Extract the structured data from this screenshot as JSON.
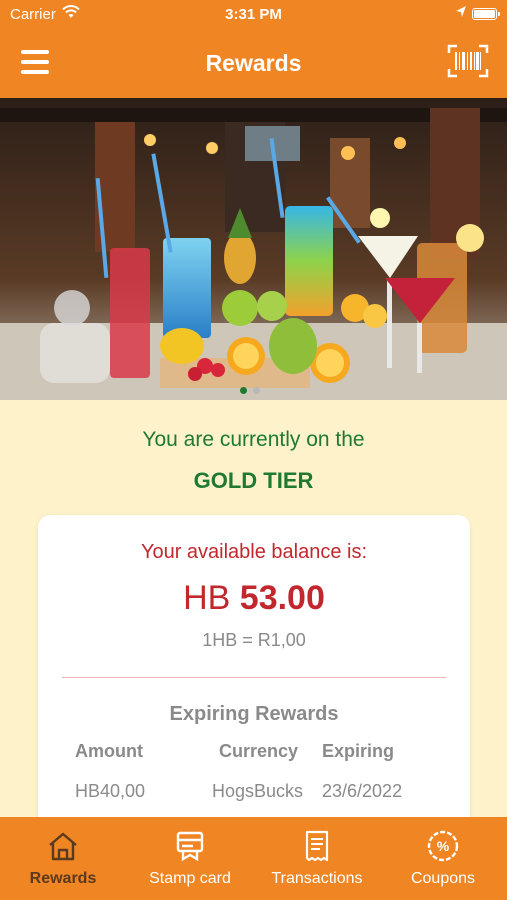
{
  "status_bar": {
    "carrier": "Carrier",
    "time": "3:31 PM"
  },
  "nav": {
    "title": "Rewards",
    "menu_icon": "hamburger-menu-icon",
    "scan_icon": "barcode-scan-icon"
  },
  "tier": {
    "prefix": "You are currently on the",
    "name": "GOLD TIER"
  },
  "balance": {
    "label": "Your available balance is:",
    "currency": "HB",
    "amount": "53.00",
    "rate": "1HB = R1,00"
  },
  "expiring": {
    "title": "Expiring Rewards",
    "headers": [
      "Amount",
      "Currency",
      "Expiring"
    ],
    "rows": [
      [
        "HB40,00",
        "HogsBucks",
        "23/6/2022"
      ]
    ]
  },
  "carousel": {
    "active_index": 0,
    "count": 2
  },
  "tabs": [
    {
      "label": "Rewards",
      "icon": "home-icon",
      "active": true
    },
    {
      "label": "Stamp card",
      "icon": "stamp-card-icon",
      "active": false
    },
    {
      "label": "Transactions",
      "icon": "receipt-icon",
      "active": false
    },
    {
      "label": "Coupons",
      "icon": "coupon-percent-icon",
      "active": false
    }
  ],
  "colors": {
    "brand_orange": "#ef8523",
    "background": "#fdf2c9",
    "tier_green": "#1f7a2e",
    "balance_red": "#c1272d",
    "active_tab": "#5a3a1e"
  }
}
